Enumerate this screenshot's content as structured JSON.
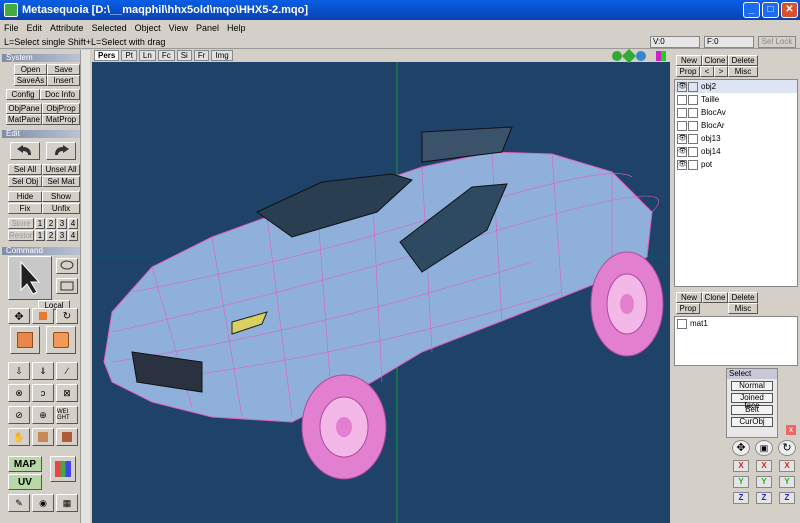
{
  "window": {
    "title": "Metasequoia [D:\\__maqphil\\hhx5old\\mqo\\HHX5-2.mqo]"
  },
  "menu": [
    "File",
    "Edit",
    "Attribute",
    "Selected",
    "Object",
    "View",
    "Panel",
    "Help"
  ],
  "hint": "L=Select single  Shift+L=Select with drag",
  "status": {
    "vertex": "V:0",
    "face": "F:0",
    "sel_lock": "Sel Lock"
  },
  "left": {
    "system_header": "System",
    "system_buttons": [
      "Open",
      "Save",
      "SaveAs",
      "Insert",
      "Config",
      "Doc Info",
      "ObjPane",
      "ObjProp",
      "MatPane",
      "MatProp"
    ],
    "edit_header": "Edit",
    "edit_buttons": [
      "Sel All",
      "Unsel All",
      "Sel Obj",
      "Sel Mat",
      "Hide",
      "Show",
      "Fix",
      "Unfix"
    ],
    "store": "Store",
    "restore": "Restore",
    "slots": [
      "1",
      "2",
      "3",
      "4"
    ],
    "command_header": "Command",
    "local_label": "Local",
    "map_label": "MAP",
    "uv_label": "UV",
    "weight_label": "WEI GHT"
  },
  "view_tabs": [
    "Pers",
    "Pt",
    "Ln",
    "Fc",
    "Si",
    "Fr",
    "Img"
  ],
  "objects": {
    "buttons": [
      "New",
      "Clone",
      "Delete",
      "Prop",
      "<",
      ">",
      "Misc"
    ],
    "items": [
      "obj2",
      "Taille",
      "BlocAv",
      "BlocAr",
      "obj13",
      "obj14",
      "pot"
    ]
  },
  "materials": {
    "buttons": [
      "New",
      "Clone",
      "Delete",
      "Prop",
      "Misc"
    ],
    "items": [
      "mat1"
    ]
  },
  "select_tool": {
    "title": "Select",
    "modes": [
      "Normal",
      "Joined face",
      "Belt",
      "CurObj"
    ],
    "axes": [
      "X",
      "Y",
      "Z"
    ]
  },
  "colors": {
    "viewport_bg": "#1e4268",
    "car_body": "#8fb0da",
    "wire": "#e060c0",
    "wheel": "#e27fcf"
  }
}
